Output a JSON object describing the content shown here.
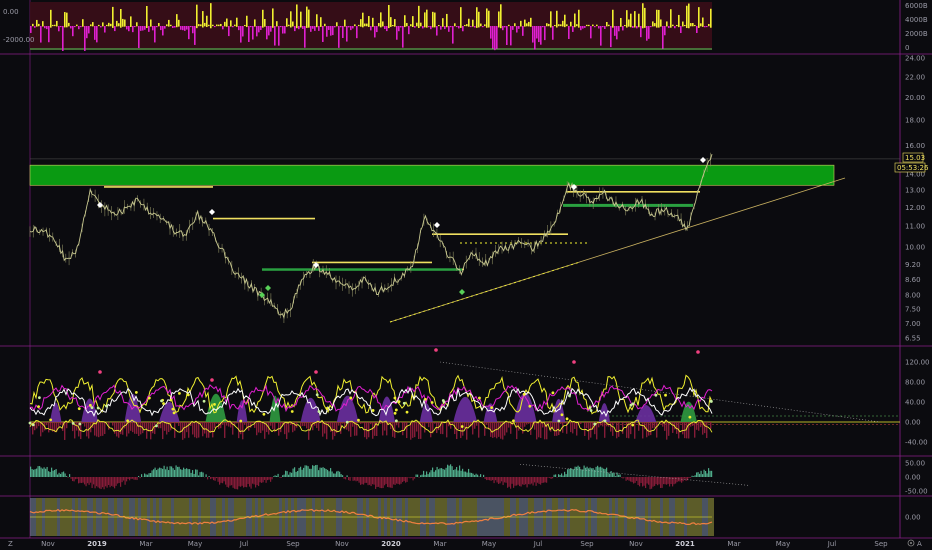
{
  "colors": {
    "background": "#0b0b0f",
    "pane_border": "#8a1f8a",
    "price_line": "#c8c890",
    "zone_green": "#0a9a12",
    "resistance_yellow": "#f0e060",
    "magenta": "#e020d0",
    "yellow": "#f0f030",
    "purple_fill": "#6a2fa0",
    "green_fill": "#2f9a40",
    "red_fill": "#9a2040",
    "teal": "#5ac8a0",
    "white": "#ffffff",
    "lime_signal": "#58d058"
  },
  "chart_data": [
    {
      "type": "bar",
      "pane": "volume_delta",
      "y_ticks_left": [
        "0.00",
        "-2000.00"
      ],
      "y_ticks_right": [
        "6000B",
        "4000B",
        "2000B",
        "0"
      ],
      "series_colors": [
        "#e020d0",
        "#f0f030"
      ]
    },
    {
      "type": "line",
      "pane": "price",
      "y_ticks": [
        "24.00",
        "22.00",
        "20.00",
        "18.00",
        "16.00",
        "15.03",
        "14.00",
        "13.00",
        "12.00",
        "11.00",
        "10.00",
        "9.20",
        "8.60",
        "8.00",
        "7.50",
        "7.00",
        "6.55"
      ],
      "log_scale": true,
      "last_price": "15.03",
      "countdown": "05:53:26",
      "x": [
        "Nov",
        "2019",
        "Mar",
        "May",
        "Jul",
        "Sep",
        "Nov",
        "2020",
        "Mar",
        "May",
        "Jul",
        "Sep",
        "Nov",
        "2021",
        "Mar",
        "May",
        "Jul",
        "Sep"
      ],
      "series": [
        {
          "values": [
            10.9,
            10.7,
            10.5,
            9.4,
            9.9,
            13.0,
            12.2,
            11.6,
            11.9,
            12.5,
            11.8,
            11.5,
            10.8,
            10.5,
            11.6,
            10.9,
            9.9,
            9.0,
            8.5,
            8.1,
            7.8,
            7.2,
            7.7,
            8.9,
            9.1,
            8.8,
            8.5,
            8.3,
            8.6,
            8.1,
            8.4,
            8.7,
            9.3,
            11.4,
            10.6,
            9.6,
            8.9,
            9.8,
            9.2,
            9.8,
            10.0,
            10.2,
            9.9,
            10.5,
            11.4,
            13.4,
            12.8,
            12.3,
            12.8,
            12.1,
            12.0,
            12.4,
            11.6,
            11.9,
            11.5,
            10.8,
            13.5,
            15.5
          ]
        }
      ],
      "zones": [
        {
          "from": 13.3,
          "to": 14.6,
          "color": "#0a9a12"
        }
      ],
      "levels": [
        13.2,
        11.4,
        9.3,
        10.6,
        12.9,
        12.1,
        9.0
      ]
    },
    {
      "type": "area",
      "pane": "oscillator",
      "y_ticks": [
        "120.00",
        "80.00",
        "40.00",
        "0.00",
        "-40.00"
      ],
      "ylim": [
        -60,
        140
      ]
    },
    {
      "type": "area",
      "pane": "momentum",
      "y_ticks": [
        "50.00",
        "0.00",
        "-50.00"
      ],
      "ylim": [
        -60,
        60
      ]
    },
    {
      "type": "area",
      "pane": "signal",
      "y_ticks": [
        "0.00"
      ],
      "ylim": [
        -1,
        1
      ]
    }
  ]
}
